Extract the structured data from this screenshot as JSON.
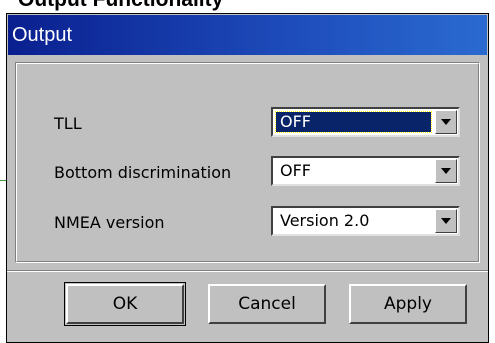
{
  "background": {
    "heading": "Output Functionality"
  },
  "dialog": {
    "title": "Output",
    "rows": [
      {
        "label": "TLL",
        "value": "OFF"
      },
      {
        "label": "Bottom discrimination",
        "value": "OFF"
      },
      {
        "label": "NMEA version",
        "value": "Version 2.0"
      }
    ],
    "buttons": {
      "ok": "OK",
      "cancel": "Cancel",
      "apply": "Apply"
    }
  },
  "colors": {
    "titlebar": "#0a1f8f",
    "dialog_bg": "#c0c0c0",
    "selection": "#0a246a"
  },
  "icons": {
    "dropdown": "chevron-down-icon"
  }
}
